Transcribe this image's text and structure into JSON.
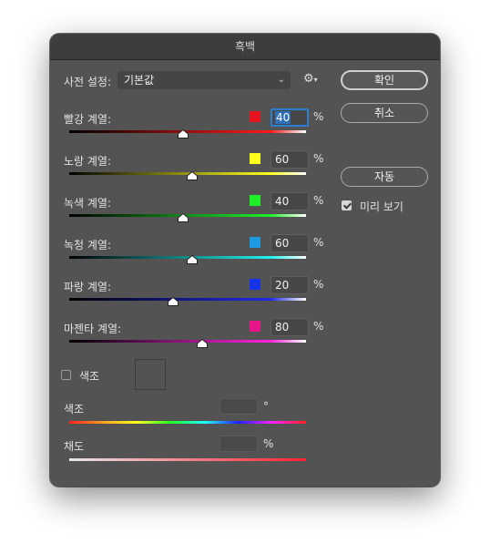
{
  "dialog": {
    "title": "흑백",
    "preset_label": "사전 설정:",
    "preset_value": "기본값",
    "gear_icon": "gear-icon",
    "buttons": {
      "ok": "확인",
      "cancel": "취소",
      "auto": "자동"
    },
    "preview": {
      "label": "미리 보기",
      "checked": true
    }
  },
  "channels": [
    {
      "label": "빨강 계열:",
      "value": "40",
      "percent": 40,
      "swatch": "#e8141c",
      "track": [
        "#000000",
        "#ff1a1a"
      ],
      "focused": true
    },
    {
      "label": "노랑 계열:",
      "value": "60",
      "percent": 60,
      "swatch": "#ffff1e",
      "track": [
        "#000000",
        "#ffff1e"
      ],
      "focused": false
    },
    {
      "label": "녹색 계열:",
      "value": "40",
      "percent": 40,
      "swatch": "#1ef02a",
      "track": [
        "#000000",
        "#1ef02a"
      ],
      "focused": false
    },
    {
      "label": "녹청 계열:",
      "value": "60",
      "percent": 60,
      "swatch": "#1e9be0",
      "track": [
        "#000000",
        "#22f0f0"
      ],
      "focused": false
    },
    {
      "label": "파랑 계열:",
      "value": "20",
      "percent": 20,
      "swatch": "#1432e8",
      "track": [
        "#000000",
        "#1e2ae8"
      ],
      "focused": false
    },
    {
      "label": "마젠타 계열:",
      "value": "80",
      "percent": 80,
      "swatch": "#e8148c",
      "track": [
        "#000000",
        "#ff22e0"
      ],
      "focused": false
    }
  ],
  "percent_sign": "%",
  "tint": {
    "label": "색조",
    "checked": false,
    "hue_label": "색조",
    "hue_unit": "°",
    "saturation_label": "채도",
    "saturation_unit": "%"
  }
}
